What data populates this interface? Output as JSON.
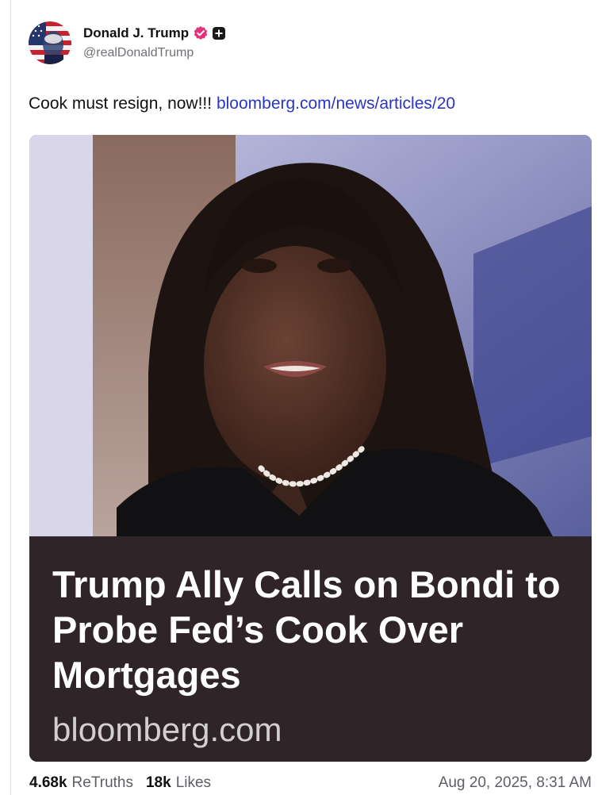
{
  "post": {
    "author": {
      "display_name": "Donald J. Trump",
      "handle": "@realDonaldTrump",
      "avatar_icon": "flag-portrait-avatar",
      "badges": [
        "verified-icon",
        "plus-icon"
      ]
    },
    "text": "Cook must resign, now!!! ",
    "link_text": "bloomberg.com/news/articles/20",
    "link_preview": {
      "image_description_icon": "article-photo",
      "title": "Trump Ally Calls on Bondi to Probe Fed’s Cook Over Mortgages",
      "domain": "bloomberg.com"
    },
    "stats": {
      "retruths_count": "4.68k",
      "retruths_label": "ReTruths",
      "likes_count": "18k",
      "likes_label": "Likes"
    },
    "timestamp": "Aug 20, 2025, 8:31 AM"
  },
  "colors": {
    "link": "#2a35c6",
    "card_background": "#2f2528",
    "verified_badge": "#e3317a",
    "muted_text": "#5e5e66"
  }
}
